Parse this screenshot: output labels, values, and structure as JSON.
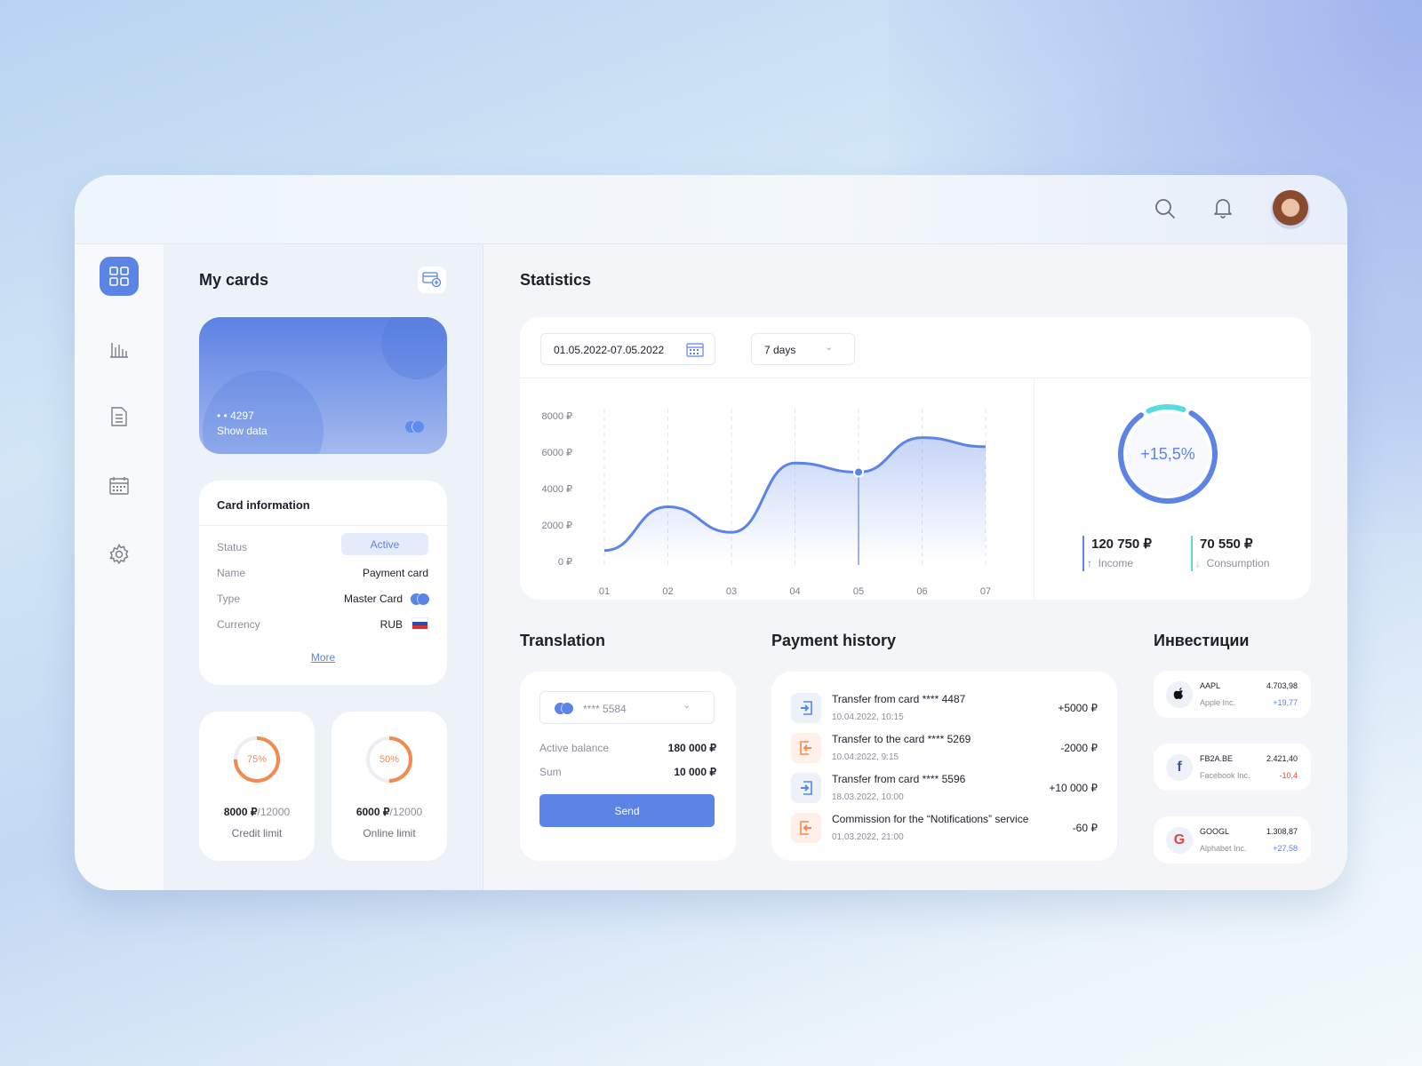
{
  "header": {
    "icons": [
      "search-icon",
      "bell-icon",
      "avatar"
    ]
  },
  "sidebar": {
    "items": [
      "dashboard-icon",
      "chart-icon",
      "document-icon",
      "calendar-icon",
      "settings-icon"
    ],
    "active": 0
  },
  "cards": {
    "title": "My cards",
    "card": {
      "number": "• • 4297",
      "show": "Show data"
    },
    "info": {
      "title": "Card information",
      "status_label": "Status",
      "status": "Active",
      "name_label": "Name",
      "name": "Payment card",
      "type_label": "Type",
      "type": "Master Card",
      "currency_label": "Currency",
      "currency": "RUB",
      "more": "More"
    },
    "limits": [
      {
        "percent": 75,
        "percent_text": "75%",
        "amount": "8000 ₽",
        "total": "/12000",
        "label": "Credit limit"
      },
      {
        "percent": 50,
        "percent_text": "50%",
        "amount": "6000 ₽",
        "total": "/12000",
        "label": "Online limit"
      }
    ]
  },
  "statistics": {
    "title": "Statistics",
    "date_range": "01.05.2022-07.05.2022",
    "period": "7 days",
    "growth": "+15,5%",
    "growth_share": 0.85,
    "income": {
      "value": "120 750 ₽",
      "label": "Income"
    },
    "consumption": {
      "value": "70 550 ₽",
      "label": "Consumption"
    }
  },
  "chart_data": {
    "type": "area",
    "categories": [
      "01",
      "02",
      "03",
      "04",
      "05",
      "06",
      "07"
    ],
    "values": [
      600,
      3000,
      1600,
      5400,
      4900,
      6800,
      6300
    ],
    "yticks": [
      "8000 ₽",
      "6000 ₽",
      "4000 ₽",
      "2000 ₽",
      "0 ₽"
    ],
    "ylim": [
      0,
      8000
    ],
    "highlight": "05",
    "color": "#5b84e6"
  },
  "translation": {
    "title": "Translation",
    "card": "**** 5584",
    "balance_label": "Active balance",
    "balance": "180 000 ₽",
    "sum_label": "Sum",
    "sum": "10 000 ₽",
    "send": "Send"
  },
  "payments": {
    "title": "Payment history",
    "items": [
      {
        "title": "Transfer from card **** 4487",
        "date": "10.04.2022, 10:15",
        "amount": "+5000 ₽",
        "dir": "in"
      },
      {
        "title": "Transfer to the card **** 5269",
        "date": "10.04.2022, 9:15",
        "amount": "-2000 ₽",
        "dir": "out"
      },
      {
        "title": "Transfer from card **** 5596",
        "date": "18.03.2022, 10:00",
        "amount": "+10 000 ₽",
        "dir": "in"
      },
      {
        "title": "Commission for the “Notifications” service",
        "date": "01.03.2022, 21:00",
        "amount": "-60 ₽",
        "dir": "out"
      }
    ]
  },
  "investments": {
    "title": "Инвестиции",
    "items": [
      {
        "ticker": "AAPL",
        "company": "Apple Inc.",
        "price": "4.703,98",
        "change": "+19,77",
        "color": "#5b84e6",
        "icon": "apple-icon"
      },
      {
        "ticker": "FB2A.BE",
        "company": "Facebook Inc.",
        "price": "2.421,40",
        "change": "-10,4",
        "color": "#e5414b",
        "icon": "facebook-icon"
      },
      {
        "ticker": "GOOGL",
        "company": "Alphabet Inc.",
        "price": "1.308,87",
        "change": "+27,58",
        "color": "#5b84e6",
        "icon": "google-icon"
      }
    ]
  }
}
